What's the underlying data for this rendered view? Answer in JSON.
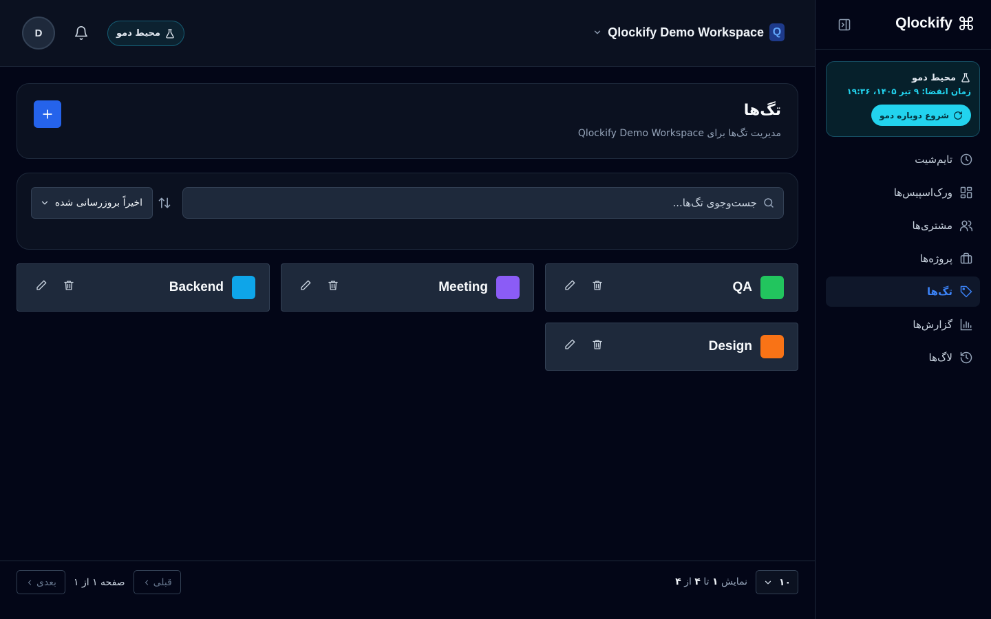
{
  "app": {
    "brand": "Qlockify"
  },
  "header": {
    "avatar_initial": "D",
    "demo_pill": "محیط دمو",
    "workspace_badge": "Q",
    "workspace_name": "Qlockify Demo Workspace"
  },
  "sidebar": {
    "demo": {
      "title": "محیط دمو",
      "expires": "زمان انقضا: ۹ تیر ۱۴۰۵، ۱۹:۳۶",
      "restart_label": "شروع دوباره دمو"
    },
    "items": [
      {
        "label": "تایم‌شیت",
        "icon": "clock-icon"
      },
      {
        "label": "ورک‌اسپیس‌ها",
        "icon": "grid-icon"
      },
      {
        "label": "مشتری‌ها",
        "icon": "users-icon"
      },
      {
        "label": "پروژه‌ها",
        "icon": "briefcase-icon"
      },
      {
        "label": "تگ‌ها",
        "icon": "tag-icon",
        "active": true
      },
      {
        "label": "گزارش‌ها",
        "icon": "bar-chart-icon"
      },
      {
        "label": "لاگ‌ها",
        "icon": "history-icon"
      }
    ]
  },
  "page": {
    "title": "تگ‌ها",
    "subtitle": "مدیریت تگ‌ها برای Qlockify Demo Workspace"
  },
  "filters": {
    "search_placeholder": "جست‌وجوی تگ‌ها...",
    "sort_label": "اخیراً بروزرسانی شده"
  },
  "tags": [
    {
      "name": "QA",
      "color": "#22c55e"
    },
    {
      "name": "Meeting",
      "color": "#8b5cf6"
    },
    {
      "name": "Backend",
      "color": "#0ea5e9"
    },
    {
      "name": "Design",
      "color": "#f97316"
    }
  ],
  "pagination": {
    "per_page": "۱۰",
    "showing_prefix": "نمایش",
    "from": "۱",
    "to_word": "تا",
    "to": "۴",
    "of_word": "از",
    "total": "۴",
    "page_info": "صفحه ۱ از ۱",
    "prev_label": "قبلی",
    "next_label": "بعدی"
  }
}
